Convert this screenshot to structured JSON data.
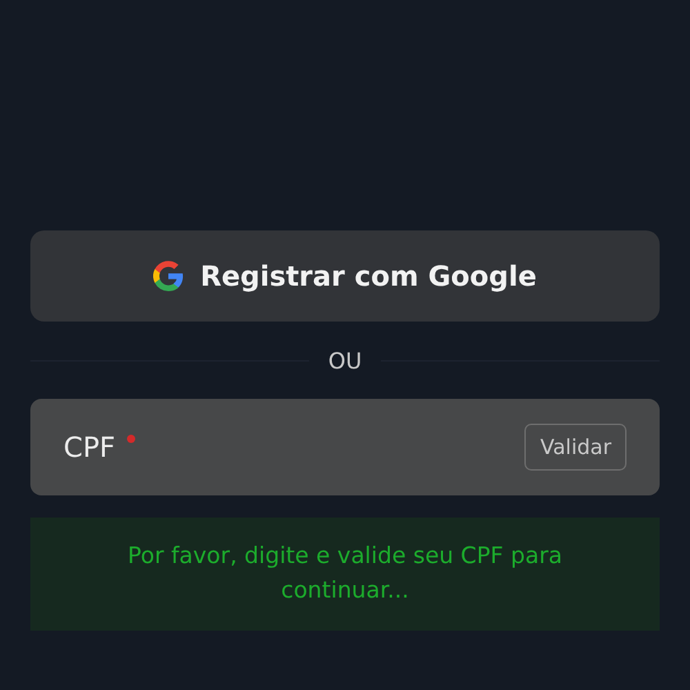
{
  "google_button": {
    "label": "Registrar com Google"
  },
  "divider": {
    "label": "OU"
  },
  "cpf_field": {
    "label": "CPF",
    "required": true,
    "button": "Validar"
  },
  "message": {
    "text": "Por favor, digite e valide seu CPF para continuar..."
  }
}
